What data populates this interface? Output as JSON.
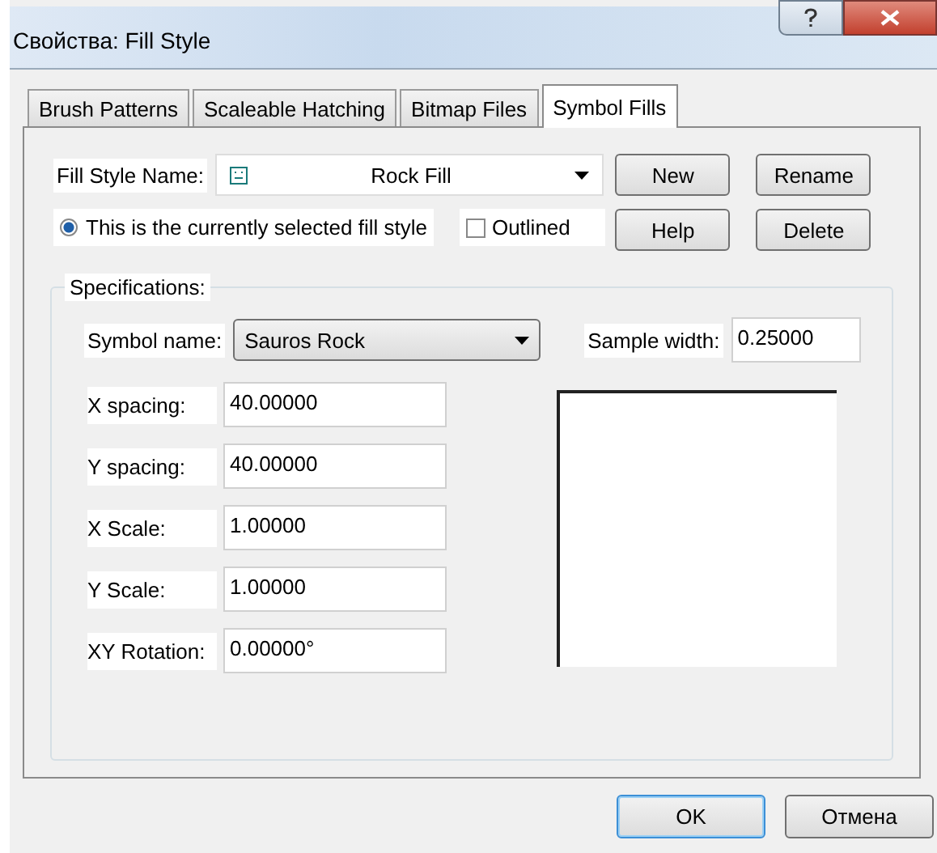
{
  "window": {
    "title": "Свойства: Fill Style"
  },
  "tabs": [
    {
      "label": "Brush Patterns",
      "selected": false
    },
    {
      "label": "Scaleable Hatching",
      "selected": false
    },
    {
      "label": "Bitmap Files",
      "selected": false
    },
    {
      "label": "Symbol Fills",
      "selected": true
    }
  ],
  "fill_style_name": {
    "label": "Fill Style Name:",
    "value": "Rock Fill"
  },
  "current_radio": {
    "label": "This is the currently selected fill style",
    "selected": true
  },
  "outlined": {
    "label": "Outlined",
    "checked": false
  },
  "side_buttons": [
    {
      "label": "New"
    },
    {
      "label": "Rename"
    },
    {
      "label": "Help"
    },
    {
      "label": "Delete"
    }
  ],
  "specifications": {
    "title": "Specifications:",
    "symbol_name": {
      "label": "Symbol name:",
      "value": "Sauros Rock"
    },
    "sample_width": {
      "label": "Sample width:",
      "value": "0.25000"
    },
    "fields": [
      {
        "label": "X spacing:",
        "value": "40.00000"
      },
      {
        "label": "Y spacing:",
        "value": "40.00000"
      },
      {
        "label": "X Scale:",
        "value": "1.00000"
      },
      {
        "label": "Y Scale:",
        "value": "1.00000"
      },
      {
        "label": "XY Rotation:",
        "value": "0.00000°"
      }
    ]
  },
  "footer_buttons": [
    {
      "label": "OK",
      "default": true
    },
    {
      "label": "Отмена",
      "default": false
    }
  ]
}
